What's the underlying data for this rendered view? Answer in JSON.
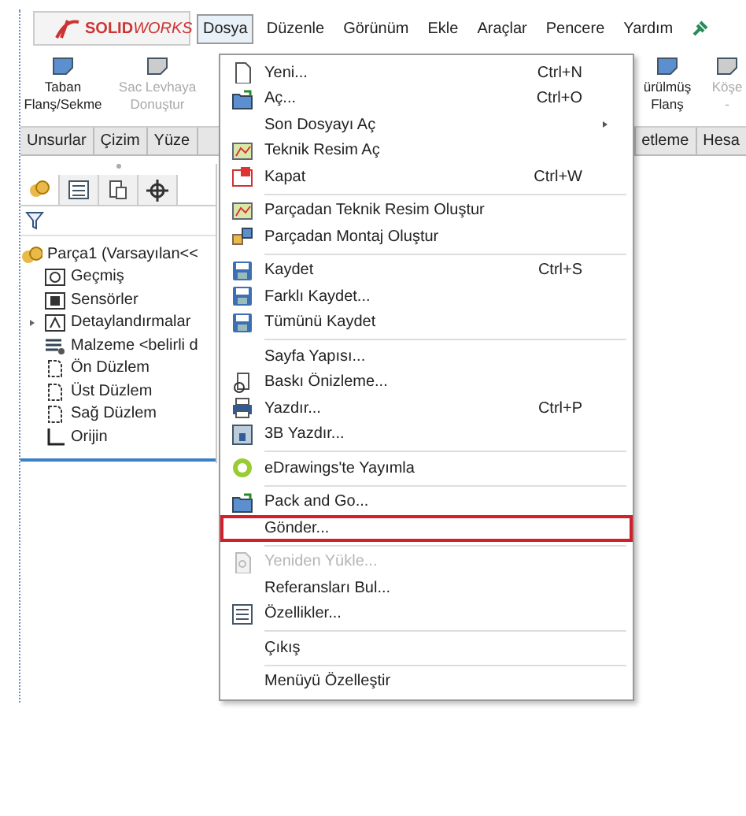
{
  "logo": {
    "brand": "SOLID",
    "suffix": "WORKS"
  },
  "menubar": [
    {
      "label": "Dosya",
      "selected": true
    },
    {
      "label": "Düzenle",
      "selected": false
    },
    {
      "label": "Görünüm",
      "selected": false
    },
    {
      "label": "Ekle",
      "selected": false
    },
    {
      "label": "Araçlar",
      "selected": false
    },
    {
      "label": "Pencere",
      "selected": false
    },
    {
      "label": "Yardım",
      "selected": false
    }
  ],
  "ribbon_left": [
    {
      "label": "Taban Flanş/Sekme",
      "disabled": false
    },
    {
      "label": "Sac Levhaya Donuştur",
      "disabled": true
    }
  ],
  "ribbon_right": [
    {
      "label": "ürülmüş Flanş",
      "disabled": false
    },
    {
      "label": "Köşe",
      "disabled": true,
      "extra": "-"
    }
  ],
  "tabs_left": [
    "Unsurlar",
    "Çizim",
    "Yüze"
  ],
  "tabs_right": [
    "etleme",
    "Hesa"
  ],
  "panel_tabs": [
    {
      "selected": true
    },
    {
      "selected": false
    },
    {
      "selected": false
    },
    {
      "selected": false
    }
  ],
  "tree": {
    "label": "Parça1 (Varsayılan<<",
    "children": [
      {
        "label": "Geçmiş",
        "kind": "folder"
      },
      {
        "label": "Sensörler",
        "kind": "sensor"
      },
      {
        "label": "Detaylandırmalar",
        "kind": "annotation",
        "expanded": false
      },
      {
        "label": "Malzeme <belirli d",
        "kind": "material"
      },
      {
        "label": "Ön Düzlem",
        "kind": "plane"
      },
      {
        "label": "Üst Düzlem",
        "kind": "plane"
      },
      {
        "label": "Sağ Düzlem",
        "kind": "plane"
      },
      {
        "label": "Orijin",
        "kind": "origin"
      }
    ]
  },
  "menu": [
    {
      "label": "Yeni...",
      "shortcut": "Ctrl+N",
      "kind": "new"
    },
    {
      "label": "Aç...",
      "shortcut": "Ctrl+O",
      "kind": "open"
    },
    {
      "label": "Son Dosyayı Aç",
      "submenu": true
    },
    {
      "label": "Teknik Resim Aç",
      "kind": "drawing"
    },
    {
      "label": "Kapat",
      "shortcut": "Ctrl+W",
      "kind": "close"
    },
    {
      "label": "Parçadan Teknik Resim Oluştur",
      "kind": "drawing",
      "separator_before": true
    },
    {
      "label": "Parçadan Montaj Oluştur",
      "kind": "assembly"
    },
    {
      "label": "Kaydet",
      "shortcut": "Ctrl+S",
      "kind": "save",
      "separator_before": true
    },
    {
      "label": "Farklı Kaydet...",
      "kind": "save"
    },
    {
      "label": "Tümünü Kaydet",
      "kind": "save"
    },
    {
      "label": "Sayfa Yapısı...",
      "separator_before": true
    },
    {
      "label": "Baskı Önizleme...",
      "kind": "preview"
    },
    {
      "label": "Yazdır...",
      "shortcut": "Ctrl+P",
      "kind": "print"
    },
    {
      "label": "3B Yazdır...",
      "kind": "print3d"
    },
    {
      "label": "eDrawings'te Yayımla",
      "kind": "edrawings",
      "separator_before": true
    },
    {
      "label": "Pack and Go...",
      "kind": "open",
      "separator_before": true
    },
    {
      "label": "Gönder...",
      "highlighted": true
    },
    {
      "label": "Yeniden Yükle...",
      "kind": "reload",
      "disabled": true,
      "separator_before": true
    },
    {
      "label": "Referansları Bul..."
    },
    {
      "label": "Özellikler...",
      "kind": "properties"
    },
    {
      "label": "Çıkış",
      "separator_before": true
    },
    {
      "label": "Menüyü Özelleştir",
      "separator_before": true
    }
  ]
}
